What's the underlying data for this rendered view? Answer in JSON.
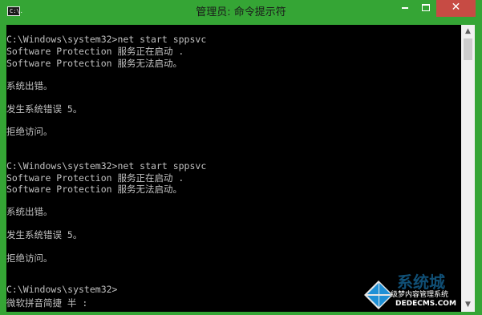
{
  "window": {
    "title": "管理员: 命令提示符",
    "icon_label": "C:\\.",
    "minimize_icon": "minimize-icon",
    "maximize_icon": "maximize-icon",
    "close_glyph": "✕",
    "accent_color": "#35a535",
    "close_color": "#c74b44"
  },
  "console": {
    "lines": [
      "C:\\Windows\\system32>net start sppsvc",
      "Software Protection 服务正在启动 .",
      "Software Protection 服务无法启动。",
      "系统出错。",
      "发生系统错误 5。",
      "拒绝访问。",
      "C:\\Windows\\system32>net start sppsvc",
      "Software Protection 服务正在启动 .",
      "Software Protection 服务无法启动。",
      "系统出错。",
      "发生系统错误 5。",
      "拒绝访问。",
      "C:\\Windows\\system32>",
      "微软拼音简捷 半 :"
    ]
  },
  "scrollbar": {
    "up_glyph": "▲",
    "down_glyph": "▼"
  },
  "watermark": {
    "brand": "系统城",
    "line1": "级梦内容管理系统",
    "line2": "DEDECMS.COM"
  }
}
